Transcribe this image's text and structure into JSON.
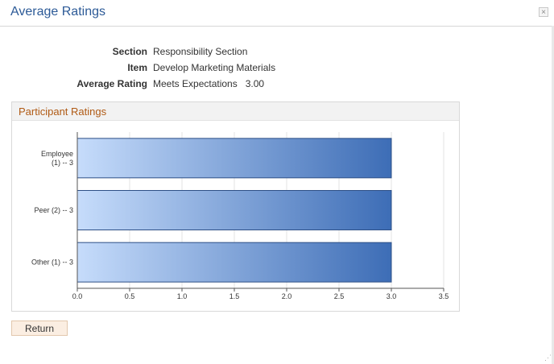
{
  "dialog": {
    "title": "Average Ratings",
    "close_symbol": "×"
  },
  "info": {
    "section_label": "Section",
    "section_value": "Responsibility Section",
    "item_label": "Item",
    "item_value": "Develop Marketing Materials",
    "avg_label": "Average Rating",
    "avg_value": "Meets Expectations   3.00"
  },
  "group": {
    "title": "Participant Ratings"
  },
  "chart_data": {
    "type": "bar",
    "orientation": "horizontal",
    "categories": [
      [
        "Employee",
        "(1) -- 3"
      ],
      [
        "Peer (2) -- 3"
      ],
      [
        "Other (1) -- 3"
      ]
    ],
    "values": [
      3.0,
      3.0,
      3.0
    ],
    "xlim": [
      0,
      3.5
    ],
    "xticks": [
      "0.0",
      "0.5",
      "1.0",
      "1.5",
      "2.0",
      "2.5",
      "3.0",
      "3.5"
    ],
    "xtick_values": [
      0,
      0.5,
      1.0,
      1.5,
      2.0,
      2.5,
      3.0,
      3.5
    ],
    "bar_color_start": "#c6dcfb",
    "bar_color_end": "#3d6db6",
    "bar_border": "#2d4f86",
    "axis_color": "#555555",
    "grid_color": "#e3e3e3"
  },
  "actions": {
    "return_label": "Return"
  },
  "icons": {
    "close": "close-icon",
    "resize": "resize-grip-icon"
  }
}
